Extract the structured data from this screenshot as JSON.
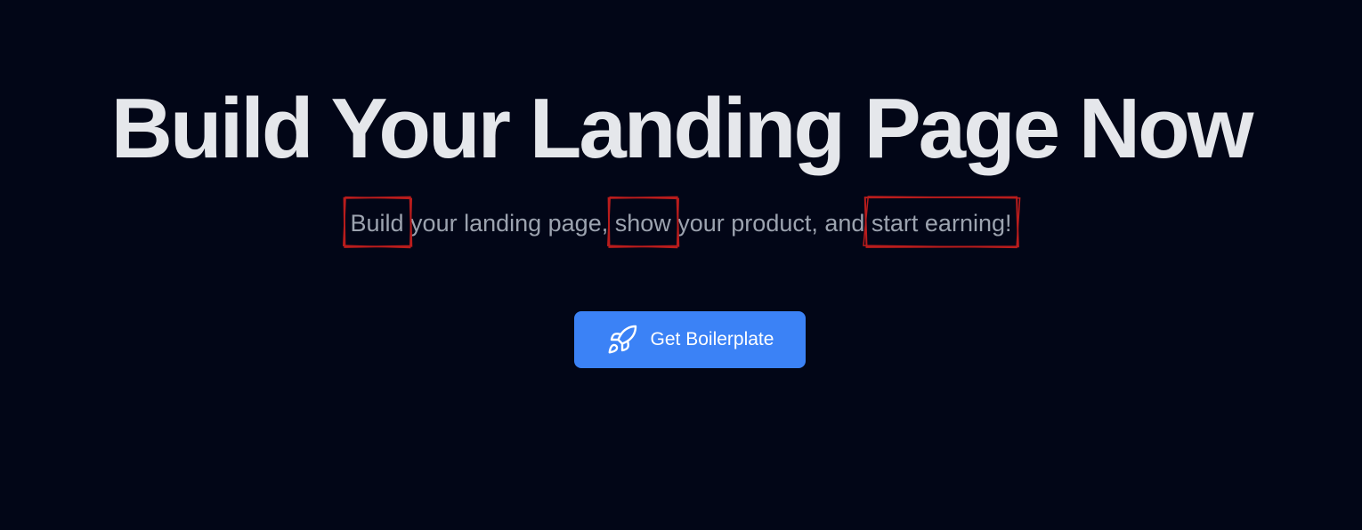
{
  "hero": {
    "title": "Build Your Landing Page Now",
    "subtitle": {
      "part1": "Build",
      "part2": " your landing page, ",
      "part3": "show",
      "part4": " your product, and ",
      "part5": "start earning!"
    },
    "highlight_color": "#b91c1c"
  },
  "cta": {
    "label": "Get Boilerplate",
    "icon": "rocket-icon",
    "color": "#3b82f6"
  },
  "theme": {
    "background": "#020617",
    "title_color": "#e5e7eb",
    "subtitle_color": "#9ca3af"
  }
}
